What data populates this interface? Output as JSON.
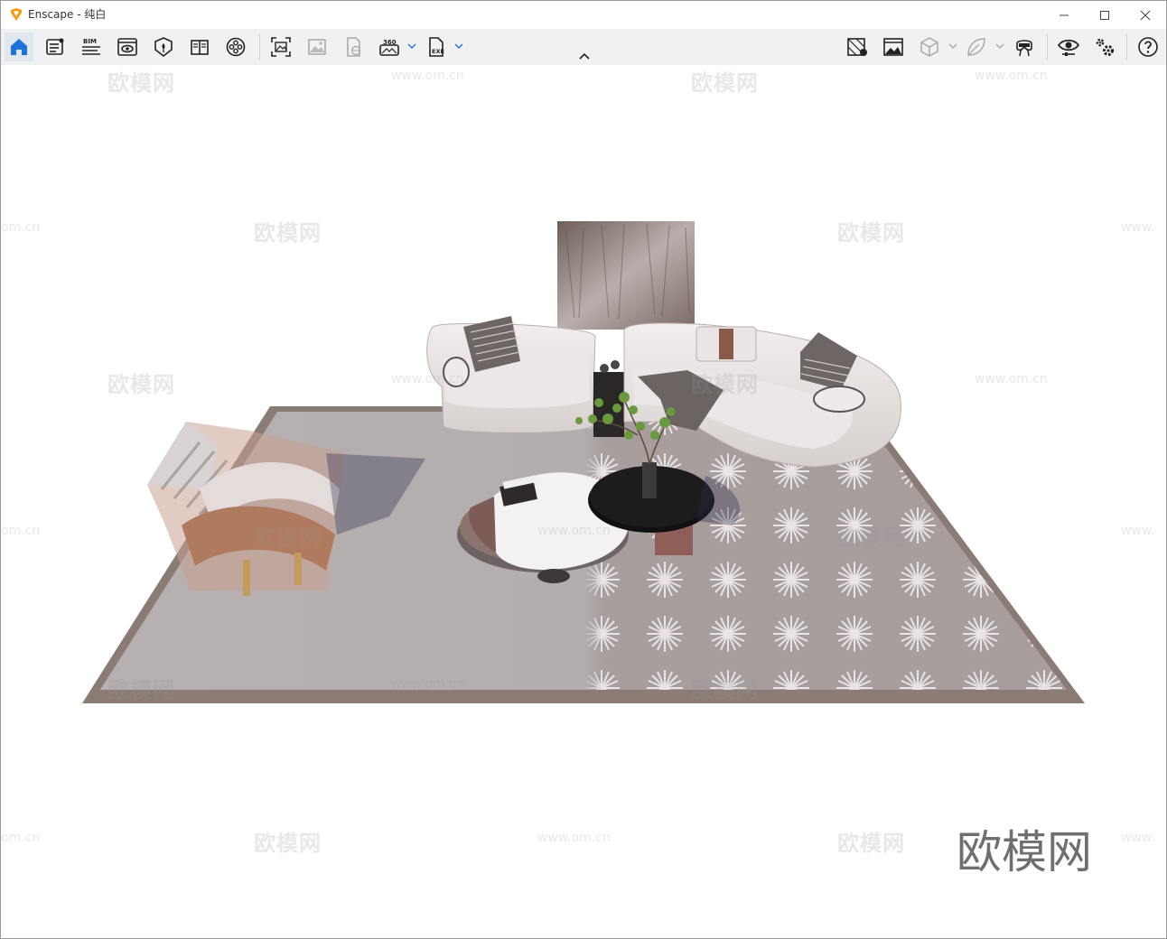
{
  "window": {
    "title": "Enscape - 纯白",
    "controls": {
      "minimize": "minimize-icon",
      "maximize": "maximize-icon",
      "close": "close-icon"
    }
  },
  "toolbar": {
    "left_tools": [
      {
        "name": "home",
        "icon": "home-icon",
        "active": true
      },
      {
        "name": "news",
        "icon": "news-icon"
      },
      {
        "name": "bim",
        "icon": "bim-icon",
        "label": "BIM"
      },
      {
        "name": "view",
        "icon": "eye-window-icon"
      },
      {
        "name": "asset",
        "icon": "asset-library-icon"
      },
      {
        "name": "views-book",
        "icon": "book-icon"
      },
      {
        "name": "video",
        "icon": "video-reel-icon"
      },
      {
        "name": "screenshot",
        "icon": "screenshot-icon"
      },
      {
        "name": "batch",
        "icon": "batch-render-icon"
      },
      {
        "name": "web",
        "icon": "web-export-icon"
      },
      {
        "name": "panorama",
        "icon": "panorama-360-icon",
        "label": "360"
      },
      {
        "name": "exe",
        "icon": "exe-export-icon",
        "label": "EXE"
      }
    ],
    "right_tools": [
      {
        "name": "material",
        "icon": "material-editor-icon"
      },
      {
        "name": "atmosphere",
        "icon": "atmosphere-icon"
      },
      {
        "name": "cube",
        "icon": "cube-icon"
      },
      {
        "name": "leaf",
        "icon": "leaf-icon"
      },
      {
        "name": "vr",
        "icon": "vr-headset-icon"
      },
      {
        "name": "visual",
        "icon": "visual-settings-icon"
      },
      {
        "name": "settings",
        "icon": "gears-icon"
      },
      {
        "name": "help",
        "icon": "help-icon"
      }
    ],
    "collapse": "chevron-up-icon"
  },
  "viewport": {
    "watermark_text": "欧模网",
    "watermark_url": "www.om.cn",
    "watermark_url_cut": "om.cn",
    "watermark_url_start": "www.",
    "brand_text": "欧模网"
  }
}
